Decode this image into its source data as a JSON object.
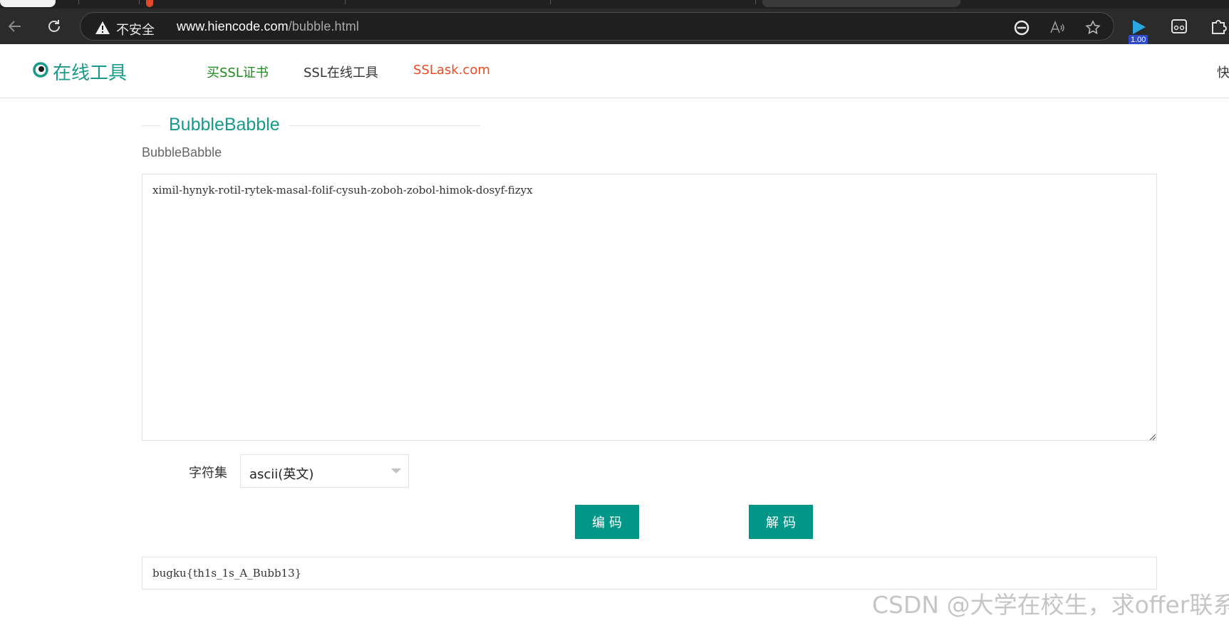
{
  "browser": {
    "security_label": "不安全",
    "url_host": "www.hiencode.com",
    "url_path": "/bubble.html",
    "extension_badge": "1.00"
  },
  "site": {
    "logo_text": "在线工具",
    "nav": [
      {
        "label": "买SSL证书",
        "color": "#1a8a1a"
      },
      {
        "label": "SSL在线工具",
        "color": "#333333"
      },
      {
        "label": "SSLask.com",
        "color": "#ee4a22"
      }
    ],
    "nav_edge_text": "快"
  },
  "main": {
    "section_title": "BubbleBabble",
    "field_label": "BubbleBabble",
    "input_value": "ximil-hynyk-rotil-rytek-masal-folif-cysuh-zoboh-zobol-himok-dosyf-fizyx",
    "charset_label": "字符集",
    "charset_selected": "ascii(英文)",
    "encode_label": "编码",
    "decode_label": "解码",
    "output_value": "bugku{th1s_1s_A_Bubb13}"
  },
  "watermark": "CSDN @大学在校生，求offer联系",
  "colors": {
    "accent": "#009688",
    "title": "#159a8e",
    "nav_green": "#1a8a1a",
    "nav_orange": "#ee4a22"
  }
}
